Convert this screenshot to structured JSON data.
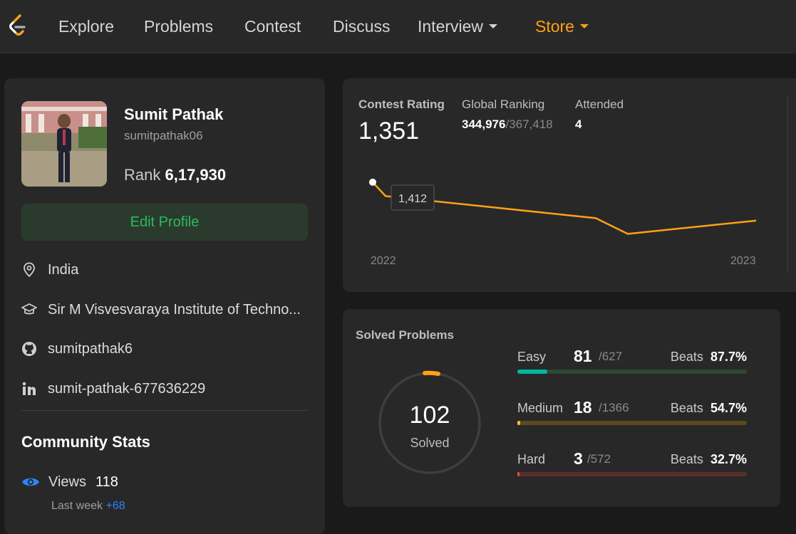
{
  "nav": {
    "items": [
      "Explore",
      "Problems",
      "Contest",
      "Discuss"
    ],
    "interview": "Interview",
    "store": "Store"
  },
  "profile": {
    "name": "Sumit Pathak",
    "username": "sumitpathak06",
    "rank_label": "Rank",
    "rank_value": "6,17,930",
    "edit_label": "Edit Profile",
    "location": "India",
    "institute": "Sir M Visvesvaraya Institute of Techno...",
    "github": "sumitpathak6",
    "linkedin": "sumit-pathak-677636229"
  },
  "community": {
    "title": "Community Stats",
    "views_label": "Views",
    "views_value": "118",
    "last_week_label": "Last week",
    "last_week_value": "+68"
  },
  "contest": {
    "rating_label": "Contest Rating",
    "rating_value": "1,351",
    "global_label": "Global Ranking",
    "global_rank": "344,976",
    "global_total": "/367,418",
    "attended_label": "Attended",
    "attended_value": "4",
    "tooltip": "1,412",
    "x_start": "2022",
    "x_end": "2023"
  },
  "chart_data": {
    "type": "line",
    "series": [
      {
        "values": [
          1412,
          1390,
          1355,
          1330,
          1351
        ]
      }
    ],
    "xlabels": [
      "2022",
      "2023"
    ],
    "highlight": "1,412",
    "color": "#ffa116"
  },
  "solved": {
    "title": "Solved Problems",
    "total": "102",
    "sub": "Solved",
    "easy": {
      "label": "Easy",
      "solved": "81",
      "total": "/627",
      "beats_label": "Beats",
      "beats": "87.7%",
      "fraction": 0.129,
      "color": "#00b8a3",
      "track": "#2a4a31"
    },
    "medium": {
      "label": "Medium",
      "solved": "18",
      "total": "/1366",
      "beats_label": "Beats",
      "beats": "54.7%",
      "fraction": 0.013,
      "color": "#ffc01e",
      "track": "#5a4a1e"
    },
    "hard": {
      "label": "Hard",
      "solved": "3",
      "total": "/572",
      "beats_label": "Beats",
      "beats": "32.7%",
      "fraction": 0.005,
      "color": "#ef4743",
      "track": "#5a2e2c"
    }
  }
}
